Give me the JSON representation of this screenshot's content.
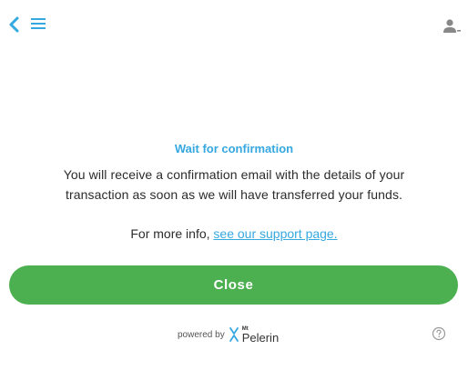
{
  "header": {
    "back_icon": "chevron-left-icon",
    "menu_icon": "hamburger-menu-icon",
    "user_icon": "user-account-icon",
    "accent_color": "#35a8e0"
  },
  "main": {
    "title": "Wait for confirmation",
    "message": "You will receive a confirmation email with the details of your transaction as soon as we will have transferred your funds.",
    "info_prefix": "For more info, ",
    "support_link": "see our support page."
  },
  "close_button": {
    "label": "Close",
    "color": "#4caf50"
  },
  "footer": {
    "powered_by": "powered by",
    "brand_small": "Mt",
    "brand_name": "Pelerin",
    "help_icon": "question-circle-icon"
  }
}
